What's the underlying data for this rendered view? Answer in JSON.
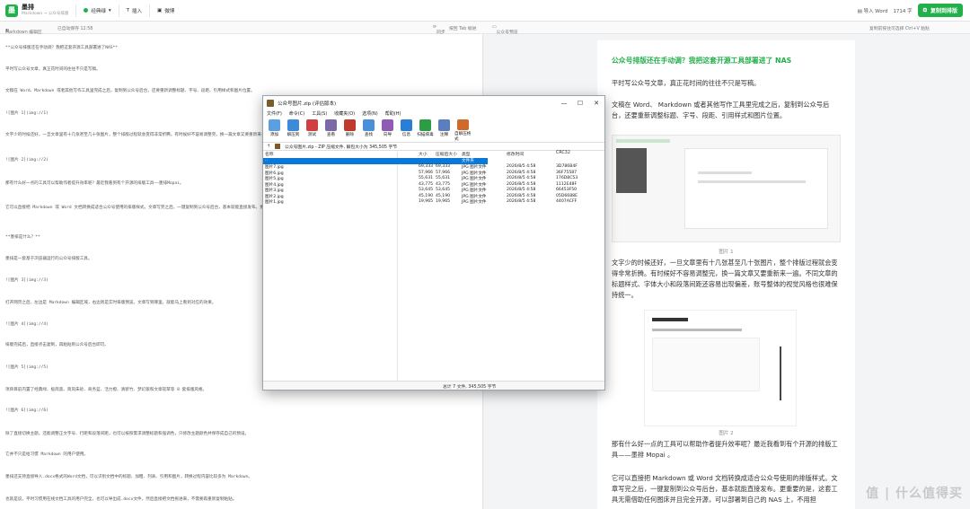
{
  "app": {
    "name": "墨排",
    "subtitle": "Markdown → 公众号排版"
  },
  "toolbar": {
    "theme": "经典绿",
    "insert": "插入",
    "weibo": "微博",
    "import_word": "导入 Word",
    "word_count": "1714 字",
    "copy": "复制到排版"
  },
  "subbar": {
    "editor_label": "Markdown 编辑区",
    "autosave": "已自动保存 12:58",
    "sync": "同步",
    "tab_hint": "按回 Tab 缩进",
    "preview_label": "公众号预览",
    "preview_hint": "复制前按住可选择 Ctrl+V 粘贴"
  },
  "editor": {
    "lines": [
      "**公众号排版还在手动调？我把这套开源工具部署进了NAS**",
      "平时写公众号文章，真正花时间的往往不只是写稿。",
      "文稿在 Word、Markdown 或者其他写作工具里完成之后，复制到公众号后台，还要重新调整标题、字号、段距、引用样式和图片位置。",
      "![图片 1](img://1)",
      "文字少的时候还好，一旦文章里有十几张甚至几十张图片，整个排版过程就会变得非常折腾。有时候好不容易调整完，换一篇文章又要重新来一遍。不同文章的标题样式、字体大小和段落间距还容易出现偏差，账号整体的视觉风格也很难保持统一。",
      "![图片 2](img://2)",
      "那有什么好一点的工具可以帮助作者提升效率呢？最近我看到有个开源的排版工具——墨排Mopai。",
      "它可以直接把 Markdown 或 Word 文档转换成适合公众号使用的排版样式。文章写完之后，一键复制到公众号后台，基本就能直接发布。更重要的是，这套工具无需借助任何图床并且完全开源，可以部署到自己的NAS上，不用担心数据泄露。",
      "**墨排是什么？**",
      "墨排是一套基于浏览器运行的公众号排版工具。",
      "![图片 3](img://3)",
      "打开网页之后，左边是 Markdown 编辑区域，右边则是实时排版预览。文章写到哪里，就能马上看到对应的效果。",
      "![图片 4](img://4)",
      "排版完成后，直接点击复制，再粘贴到公众号后台即可。",
      "![图片 5](img://5)",
      "项目目前内置了经典绿、极简黑、简风朱砂、商务蓝、活力橙、清新竹、梦幻紫和文章软萃等 8 套排版风格。",
      "![图片 6](img://6)",
      "除了直接切换主题，还能调整正文字号、行距和段落间距，也可以按照需求调整标题和强调色，只修改主题颜色并保存成自己的预设。",
      "它并不只是给习惯 Markdown 的用户使用。",
      "墨排还支持直接导入.docx格式的Word文档，可以识别文档中的标题、加粗、列表、引用和图片，转换过程内容比较多为 Markdown。",
      "也就是说，平时习惯用在线文档工具的用户完全，也可以导出成.docx文件，然后直接把文档拖进来，不需要再重新复制粘贴。"
    ]
  },
  "preview": {
    "title": "公众号排版还在手动调？我把这套开源工具部署进了 NAS",
    "p1": "平时写公众号文章，真正花时间的往往不只是写稿。",
    "p2": "文稿在 Word、 Markdown 或者其他写作工具里完成之后，复制到公众号后台，还要重新调整标题、字号、段距、引用样式和图片位置。",
    "cap1": "图片 1",
    "p3": "文字少的时候还好，一旦文章里有十几张甚至几十张图片，整个排版过程就会变得非常折腾。有时候好不容易调整完，换一篇文章又要重新来一遍。不同文章的标题样式、字体大小和段落间距还容易出现偏差，账号整体的视觉风格也很难保持统一。",
    "cap2": "图片 2",
    "p4": "那有什么好一点的工具可以帮助作者提升效率呢？最近我看到有个开源的排版工具——墨排 Mopai 。",
    "p5": "它可以直接把 Markdown 或 Word 文档转换成适合公众号使用的排版样式。文章写完之后，一键复制到公众号后台，基本就能直接发布。更重要的是，这套工具无需借助任何图床并且完全开源，可以部署到自己的 NAS 上，不用担"
  },
  "dialog": {
    "title": "公众号图片.zip (评估版本)",
    "menu": [
      "文件(F)",
      "命令(C)",
      "工具(S)",
      "收藏夹(O)",
      "选项(N)",
      "帮助(H)"
    ],
    "tools": [
      {
        "label": "添加",
        "color": "#5aa0e0"
      },
      {
        "label": "解压到",
        "color": "#3c8ad8"
      },
      {
        "label": "测试",
        "color": "#d04040"
      },
      {
        "label": "查看",
        "color": "#7a6aa8"
      },
      {
        "label": "删除",
        "color": "#c0392b"
      },
      {
        "label": "查找",
        "color": "#4a90d9"
      },
      {
        "label": "向导",
        "color": "#8e5bb5"
      },
      {
        "label": "信息",
        "color": "#2a7fd4"
      },
      {
        "label": "扫描病毒",
        "color": "#2e9c44"
      },
      {
        "label": "注释",
        "color": "#5a7fc0"
      },
      {
        "label": "自解压格式",
        "color": "#d06a2a"
      }
    ],
    "path": "公众号图片.zip - ZIP 压缩文件, 解包大小为 345,505 字节",
    "columns": [
      "名称",
      "大小",
      "压缩后大小",
      "类型",
      "修改时间",
      "CRC32"
    ],
    "parent_row": {
      "name": "..",
      "type": "文件夹"
    },
    "files": [
      {
        "name": "图片7.jpg",
        "size": "69,333",
        "packed": "69,333",
        "type": "JPG 图片文件",
        "mtime": "2026/8/5 4:58",
        "crc": "3D786B4F"
      },
      {
        "name": "图片6.jpg",
        "size": "57,966",
        "packed": "57,966",
        "type": "JPG 图片文件",
        "mtime": "2026/8/5 4:58",
        "crc": "36F75587"
      },
      {
        "name": "图片5.jpg",
        "size": "55,631",
        "packed": "55,631",
        "type": "JPG 图片文件",
        "mtime": "2026/8/5 4:58",
        "crc": "176D8C53"
      },
      {
        "name": "图片4.jpg",
        "size": "43,775",
        "packed": "43,775",
        "type": "JPG 图片文件",
        "mtime": "2026/8/5 4:58",
        "crc": "1112E48F"
      },
      {
        "name": "图片3.jpg",
        "size": "53,645",
        "packed": "53,645",
        "type": "JPG 图片文件",
        "mtime": "2026/8/5 4:58",
        "crc": "66453F50"
      },
      {
        "name": "图片2.jpg",
        "size": "45,190",
        "packed": "45,190",
        "type": "JPG 图片文件",
        "mtime": "2026/8/5 4:58",
        "crc": "05D6688E"
      },
      {
        "name": "图片1.jpg",
        "size": "19,965",
        "packed": "19,965",
        "type": "JPG 图片文件",
        "mtime": "2026/8/5 4:58",
        "crc": "4407ACFF"
      }
    ],
    "status": "总计 7 文件, 345,505 字节"
  },
  "watermark": "值 | 什么值得买",
  "colors": {
    "accent": "#22b04a",
    "selection": "#0a78d7"
  }
}
